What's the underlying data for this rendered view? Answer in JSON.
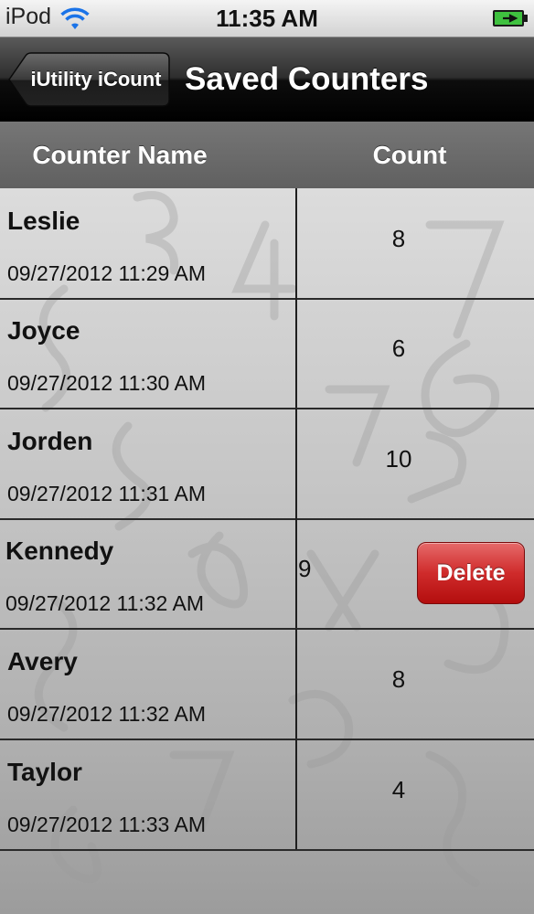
{
  "status_bar": {
    "carrier": "iPod",
    "time": "11:35 AM",
    "wifi_icon": "wifi-icon",
    "battery_icon": "battery-charging-icon"
  },
  "nav": {
    "back_label": "iUtility iCount",
    "title": "Saved Counters"
  },
  "table": {
    "columns": [
      "Counter Name",
      "Count"
    ],
    "rows": [
      {
        "name": "Leslie",
        "date": "09/27/2012  11:29 AM",
        "count": "8"
      },
      {
        "name": "Joyce",
        "date": "09/27/2012  11:30 AM",
        "count": "6"
      },
      {
        "name": "Jorden",
        "date": "09/27/2012  11:31 AM",
        "count": "10"
      },
      {
        "name": "Kennedy",
        "date": "09/27/2012  11:32 AM",
        "count": "9",
        "delete_label": "Delete"
      },
      {
        "name": "Avery",
        "date": "09/27/2012  11:32 AM",
        "count": "8"
      },
      {
        "name": "Taylor",
        "date": "09/27/2012  11:33 AM",
        "count": "4"
      }
    ]
  },
  "colors": {
    "delete_button": "#cf2b2b",
    "nav_bar": "#000000",
    "header_bar": "#6b6b6b"
  }
}
